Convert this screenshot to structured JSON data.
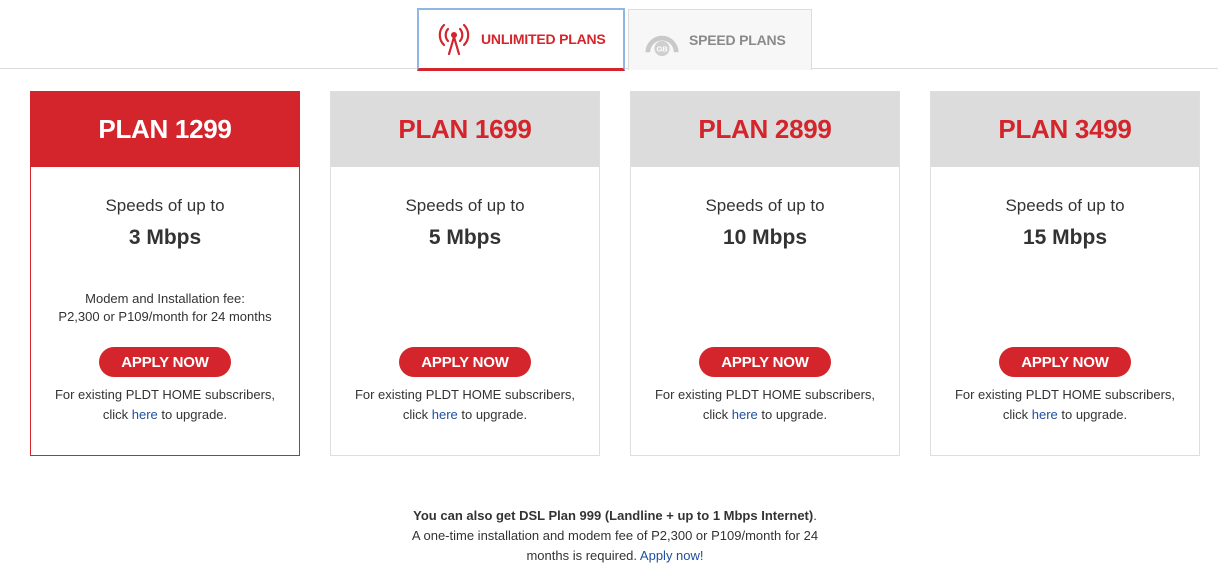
{
  "tabs": [
    {
      "label": "UNLIMITED PLANS",
      "icon": "signal-tower-icon",
      "active": true
    },
    {
      "label": "SPEED PLANS",
      "icon": "gb-gauge-icon",
      "active": false
    }
  ],
  "colors": {
    "accent": "#d3252b",
    "link": "#1f4fa0",
    "muted": "#dcdcdc"
  },
  "plans": [
    {
      "name": "PLAN 1299",
      "speed_label": "Speeds of up to",
      "speed": "3 Mbps",
      "fee_line1": "Modem and Installation fee:",
      "fee_line2": "P2,300 or P109/month for 24 months",
      "apply_label": "APPLY NOW",
      "existing_line1": "For existing PLDT HOME subscribers,",
      "existing_pre": "click ",
      "existing_link": "here",
      "existing_post": " to upgrade."
    },
    {
      "name": "PLAN 1699",
      "speed_label": "Speeds of up to",
      "speed": "5 Mbps",
      "apply_label": "APPLY NOW",
      "existing_line1": "For existing PLDT HOME subscribers,",
      "existing_pre": "click ",
      "existing_link": "here",
      "existing_post": " to upgrade."
    },
    {
      "name": "PLAN 2899",
      "speed_label": "Speeds of up to",
      "speed": "10 Mbps",
      "apply_label": "APPLY NOW",
      "existing_line1": "For existing PLDT HOME subscribers,",
      "existing_pre": "click ",
      "existing_link": "here",
      "existing_post": " to upgrade."
    },
    {
      "name": "PLAN 3499",
      "speed_label": "Speeds of up to",
      "speed": "15 Mbps",
      "apply_label": "APPLY NOW",
      "existing_line1": "For existing PLDT HOME subscribers,",
      "existing_pre": "click ",
      "existing_link": "here",
      "existing_post": " to upgrade."
    }
  ],
  "footer": {
    "bold_text": "You can also get DSL Plan 999 (Landline + up to 1 Mbps Internet)",
    "bold_end": ".",
    "line2": "A one-time installation and modem fee of P2,300 or P109/month for 24",
    "line3_pre": "months is required. ",
    "line3_link": "Apply now!"
  }
}
